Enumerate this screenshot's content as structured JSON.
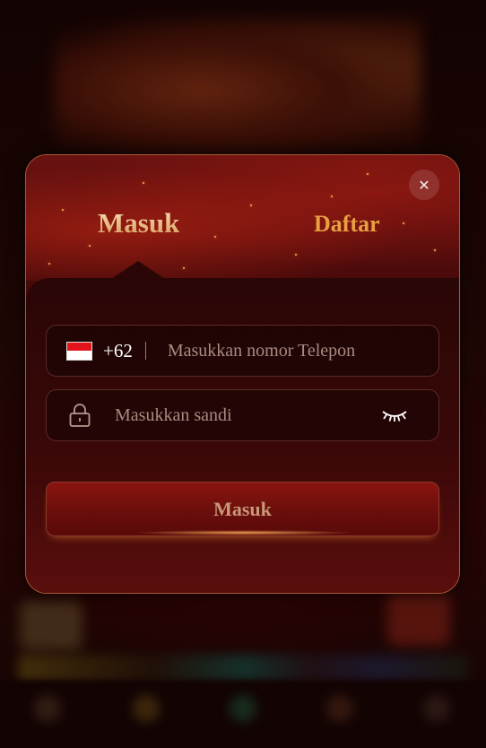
{
  "modal": {
    "tabs": {
      "login": "Masuk",
      "register": "Daftar"
    },
    "close_icon": "close-icon",
    "phone": {
      "flag": "indonesia-flag-icon",
      "country_code": "+62",
      "placeholder": "Masukkan nomor Telepon",
      "value": ""
    },
    "password": {
      "lock": "lock-icon",
      "placeholder": "Masukkan sandi",
      "value": "",
      "eye": "eye-closed-icon"
    },
    "submit_label": "Masuk"
  },
  "colors": {
    "login_tab_gold": "#f3cd9a",
    "register_tab_orange": "#e8a040",
    "modal_border": "#a85a38",
    "submit_text": "#c89878",
    "flag_red": "#e3131b"
  }
}
